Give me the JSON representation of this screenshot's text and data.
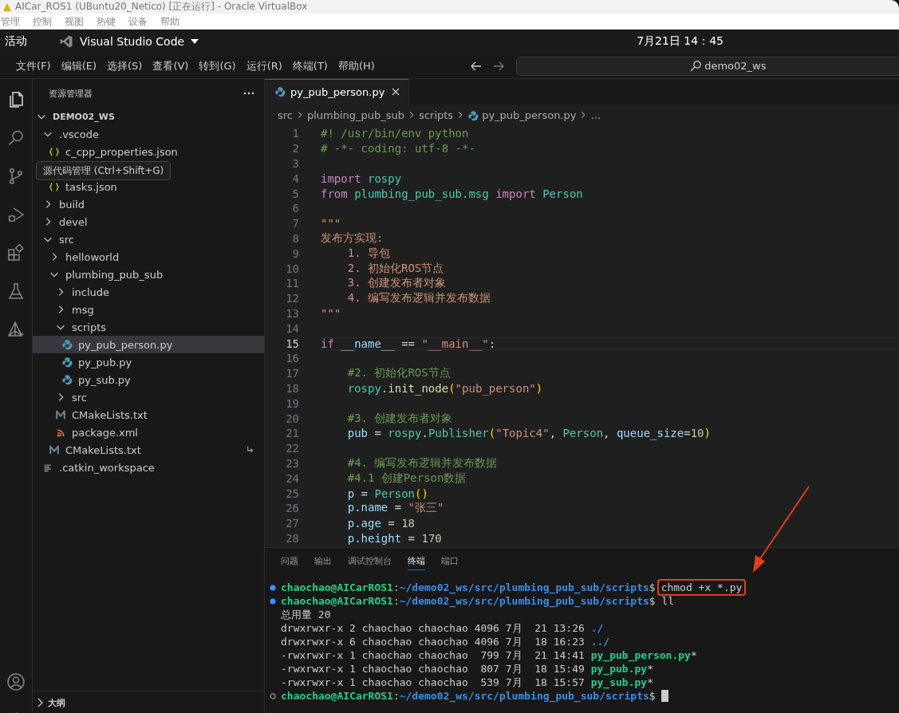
{
  "vbox": {
    "title": "AICar_ROS1 (UBuntu20_Netico) [正在运行] - Oracle VirtualBox",
    "menu": [
      "管理",
      "控制",
      "视图",
      "热键",
      "设备",
      "帮助"
    ]
  },
  "topbar": {
    "activities": "活动",
    "app": "Visual Studio Code",
    "clock": "7月21日  14：45"
  },
  "menubar": {
    "items": [
      "文件(F)",
      "编辑(E)",
      "选择(S)",
      "查看(V)",
      "转到(G)",
      "运行(R)",
      "终端(T)",
      "帮助(H)"
    ],
    "search": "demo02_ws"
  },
  "activity_bar": [
    {
      "kind": "explorer",
      "selected": true
    },
    {
      "kind": "search",
      "selected": false
    },
    {
      "kind": "scm",
      "selected": false
    },
    {
      "kind": "debug",
      "selected": false
    },
    {
      "kind": "extensions",
      "selected": false
    },
    {
      "kind": "testing",
      "selected": false
    },
    {
      "kind": "ros",
      "selected": false
    }
  ],
  "activity_bottom": [
    {
      "kind": "account"
    },
    {
      "kind": "settings"
    }
  ],
  "sidebar": {
    "title": "资源管理器",
    "tree": [
      {
        "label": "DEMO02_WS",
        "kind": "root",
        "expanded": true,
        "selected": false,
        "children": [
          {
            "label": ".vscode",
            "kind": "folder",
            "expanded": true,
            "selected": false,
            "children": [
              {
                "label": "c_cpp_properties.json",
                "kind": "json",
                "selected": false
              },
              {
                "label": "源代码管理 (Ctrl+Shift+G)",
                "kind": "tooltip"
              },
              {
                "label": "tasks.json",
                "kind": "json",
                "selected": false
              }
            ]
          },
          {
            "label": "build",
            "kind": "folder",
            "expanded": false,
            "selected": false
          },
          {
            "label": "devel",
            "kind": "folder",
            "expanded": false,
            "selected": false
          },
          {
            "label": "src",
            "kind": "folder",
            "expanded": true,
            "selected": false,
            "children": [
              {
                "label": "helloworld",
                "kind": "folder",
                "expanded": false,
                "selected": false
              },
              {
                "label": "plumbing_pub_sub",
                "kind": "folder",
                "expanded": true,
                "selected": false,
                "children": [
                  {
                    "label": "include",
                    "kind": "folder",
                    "expanded": false,
                    "selected": false
                  },
                  {
                    "label": "msg",
                    "kind": "folder",
                    "expanded": false,
                    "selected": false
                  },
                  {
                    "label": "scripts",
                    "kind": "folder",
                    "expanded": true,
                    "selected": false,
                    "children": [
                      {
                        "label": "py_pub_person.py",
                        "kind": "python",
                        "selected": true
                      },
                      {
                        "label": "py_pub.py",
                        "kind": "python",
                        "selected": false
                      },
                      {
                        "label": "py_sub.py",
                        "kind": "python",
                        "selected": false
                      }
                    ]
                  },
                  {
                    "label": "src",
                    "kind": "folder",
                    "expanded": false,
                    "selected": false
                  },
                  {
                    "label": "CMakeLists.txt",
                    "kind": "cmake",
                    "selected": false
                  },
                  {
                    "label": "package.xml",
                    "kind": "xml",
                    "selected": false
                  }
                ]
              },
              {
                "label": "CMakeLists.txt",
                "kind": "cmake",
                "selected": false,
                "symlink": true
              }
            ]
          },
          {
            "label": ".catkin_workspace",
            "kind": "file",
            "selected": false
          }
        ]
      }
    ],
    "outline": "大纲"
  },
  "editor": {
    "tabs": [
      {
        "label": "py_pub_person.py",
        "selected": true
      }
    ],
    "breadcrumb": [
      "src",
      "plumbing_pub_sub",
      "scripts",
      "py_pub_person.py",
      "…"
    ],
    "lines": [
      {
        "n": "1",
        "current": false,
        "segs": [
          {
            "kind": "comment",
            "text": "#! /usr/bin/env python"
          }
        ]
      },
      {
        "n": "2",
        "current": false,
        "segs": [
          {
            "kind": "comment",
            "text": "# -*- coding: utf-8 -*-"
          }
        ]
      },
      {
        "n": "3",
        "current": false
      },
      {
        "n": "4",
        "current": false,
        "segs": [
          {
            "kind": "keyword",
            "text": "import "
          },
          {
            "kind": "module",
            "text": "rospy"
          }
        ]
      },
      {
        "n": "5",
        "current": false,
        "segs": [
          {
            "kind": "keyword",
            "text": "from "
          },
          {
            "kind": "module",
            "text": "plumbing_pub_sub.msg "
          },
          {
            "kind": "keyword",
            "text": "import "
          },
          {
            "kind": "module",
            "text": "Person"
          }
        ]
      },
      {
        "n": "6",
        "current": false
      },
      {
        "n": "7",
        "current": false,
        "segs": [
          {
            "kind": "string",
            "text": "\"\"\""
          }
        ]
      },
      {
        "n": "8",
        "current": false,
        "segs": [
          {
            "kind": "string",
            "text": "发布方实现:"
          }
        ]
      },
      {
        "n": "9",
        "current": false,
        "segs": [
          {
            "kind": "string",
            "text": "    1. 导包"
          }
        ]
      },
      {
        "n": "10",
        "current": false,
        "segs": [
          {
            "kind": "string",
            "text": "    2. 初始化ROS节点"
          }
        ]
      },
      {
        "n": "11",
        "current": false,
        "segs": [
          {
            "kind": "string",
            "text": "    3. 创建发布者对象"
          }
        ]
      },
      {
        "n": "12",
        "current": false,
        "segs": [
          {
            "kind": "string",
            "text": "    4. 编写发布逻辑并发布数据"
          }
        ]
      },
      {
        "n": "13",
        "current": false,
        "segs": [
          {
            "kind": "string",
            "text": "\"\"\""
          }
        ]
      },
      {
        "n": "14",
        "current": false
      },
      {
        "n": "15",
        "current": true,
        "segs": [
          {
            "kind": "keyword",
            "text": "if "
          },
          {
            "kind": "variable",
            "text": "__name__"
          },
          {
            "kind": "plain",
            "text": " == "
          },
          {
            "kind": "string",
            "text": "\"__main__\""
          },
          {
            "kind": "plain",
            "text": ":"
          }
        ]
      },
      {
        "n": "16",
        "current": false
      },
      {
        "n": "17",
        "current": false,
        "segs": [
          {
            "kind": "comment",
            "text": "    #2. 初始化ROS节点"
          }
        ]
      },
      {
        "n": "18",
        "current": false,
        "segs": [
          {
            "kind": "module",
            "text": "    rospy"
          },
          {
            "kind": "plain",
            "text": "."
          },
          {
            "kind": "function",
            "text": "init_node"
          },
          {
            "kind": "paren",
            "text": "("
          },
          {
            "kind": "string",
            "text": "\"pub_person\""
          },
          {
            "kind": "paren",
            "text": ")"
          }
        ]
      },
      {
        "n": "19",
        "current": false
      },
      {
        "n": "20",
        "current": false,
        "segs": [
          {
            "kind": "comment",
            "text": "    #3. 创建发布者对象"
          }
        ]
      },
      {
        "n": "21",
        "current": false,
        "segs": [
          {
            "kind": "variable",
            "text": "    pub"
          },
          {
            "kind": "plain",
            "text": " = "
          },
          {
            "kind": "module",
            "text": "rospy"
          },
          {
            "kind": "plain",
            "text": "."
          },
          {
            "kind": "module",
            "text": "Publisher"
          },
          {
            "kind": "paren",
            "text": "("
          },
          {
            "kind": "string",
            "text": "\"Topic4\""
          },
          {
            "kind": "plain",
            "text": ", "
          },
          {
            "kind": "module",
            "text": "Person"
          },
          {
            "kind": "plain",
            "text": ", "
          },
          {
            "kind": "variable",
            "text": "queue_size"
          },
          {
            "kind": "plain",
            "text": "="
          },
          {
            "kind": "number",
            "text": "10"
          },
          {
            "kind": "paren",
            "text": ")"
          }
        ]
      },
      {
        "n": "22",
        "current": false
      },
      {
        "n": "23",
        "current": false,
        "segs": [
          {
            "kind": "comment",
            "text": "    #4. 编写发布逻辑并发布数据"
          }
        ]
      },
      {
        "n": "24",
        "current": false,
        "segs": [
          {
            "kind": "comment",
            "text": "    #4.1 创建Person数据"
          }
        ]
      },
      {
        "n": "25",
        "current": false,
        "segs": [
          {
            "kind": "variable",
            "text": "    p"
          },
          {
            "kind": "plain",
            "text": " = "
          },
          {
            "kind": "module",
            "text": "Person"
          },
          {
            "kind": "paren",
            "text": "()"
          }
        ]
      },
      {
        "n": "26",
        "current": false,
        "segs": [
          {
            "kind": "variable",
            "text": "    p.name"
          },
          {
            "kind": "plain",
            "text": " = "
          },
          {
            "kind": "string",
            "text": "\"张三\""
          }
        ]
      },
      {
        "n": "27",
        "current": false,
        "segs": [
          {
            "kind": "variable",
            "text": "    p.age"
          },
          {
            "kind": "plain",
            "text": " = "
          },
          {
            "kind": "number",
            "text": "18"
          }
        ]
      },
      {
        "n": "28",
        "current": false,
        "segs": [
          {
            "kind": "variable",
            "text": "    p.height"
          },
          {
            "kind": "plain",
            "text": " = "
          },
          {
            "kind": "number",
            "text": "170"
          }
        ]
      }
    ]
  },
  "panel": {
    "tabs": [
      {
        "label": "问题",
        "selected": false
      },
      {
        "label": "输出",
        "selected": false
      },
      {
        "label": "调试控制台",
        "selected": false
      },
      {
        "label": "终端",
        "selected": true
      },
      {
        "label": "端口",
        "selected": false
      }
    ],
    "terminal": [
      {
        "kind": "done",
        "segs": [
          {
            "kind": "user",
            "text": "chaochao@AICarROS1"
          },
          {
            "kind": "plain",
            "text": ":"
          },
          {
            "kind": "path",
            "text": "~/demo02_ws/src/plumbing_pub_sub/scripts"
          },
          {
            "kind": "plain",
            "text": "$"
          },
          {
            "kind": "plain",
            "text": "chmod +x *.py",
            "annotated": true
          }
        ]
      },
      {
        "kind": "done",
        "segs": [
          {
            "kind": "user",
            "text": "chaochao@AICarROS1"
          },
          {
            "kind": "plain",
            "text": ":"
          },
          {
            "kind": "path",
            "text": "~/demo02_ws/src/plumbing_pub_sub/scripts"
          },
          {
            "kind": "plain",
            "text": "$ ll"
          }
        ]
      },
      {
        "kind": "output",
        "segs": [
          {
            "kind": "plain",
            "text": "总用量 20"
          }
        ]
      },
      {
        "kind": "output",
        "segs": [
          {
            "kind": "plain",
            "text": "drwxrwxr-x 2 chaochao chaochao 4096 7月  21 13:26 "
          },
          {
            "kind": "path",
            "text": "./"
          }
        ]
      },
      {
        "kind": "output",
        "segs": [
          {
            "kind": "plain",
            "text": "drwxrwxr-x 6 chaochao chaochao 4096 7月  18 16:23 "
          },
          {
            "kind": "path",
            "text": "../"
          }
        ]
      },
      {
        "kind": "output",
        "segs": [
          {
            "kind": "plain",
            "text": "-rwxrwxr-x 1 chaochao chaochao  799 7月  21 14:41 "
          },
          {
            "kind": "user",
            "text": "py_pub_person.py"
          },
          {
            "kind": "plain",
            "text": "*"
          }
        ]
      },
      {
        "kind": "output",
        "segs": [
          {
            "kind": "plain",
            "text": "-rwxrwxr-x 1 chaochao chaochao  807 7月  18 15:49 "
          },
          {
            "kind": "user",
            "text": "py_pub.py"
          },
          {
            "kind": "plain",
            "text": "*"
          }
        ]
      },
      {
        "kind": "output",
        "segs": [
          {
            "kind": "plain",
            "text": "-rwxrwxr-x 1 chaochao chaochao  539 7月  18 15:57 "
          },
          {
            "kind": "user",
            "text": "py_sub.py"
          },
          {
            "kind": "plain",
            "text": "*"
          }
        ]
      },
      {
        "kind": "idle",
        "cursor": true,
        "segs": [
          {
            "kind": "user",
            "text": "chaochao@AICarROS1"
          },
          {
            "kind": "plain",
            "text": ":"
          },
          {
            "kind": "path",
            "text": "~/demo02_ws/src/plumbing_pub_sub/scripts"
          },
          {
            "kind": "plain",
            "text": "$ "
          }
        ]
      }
    ]
  }
}
